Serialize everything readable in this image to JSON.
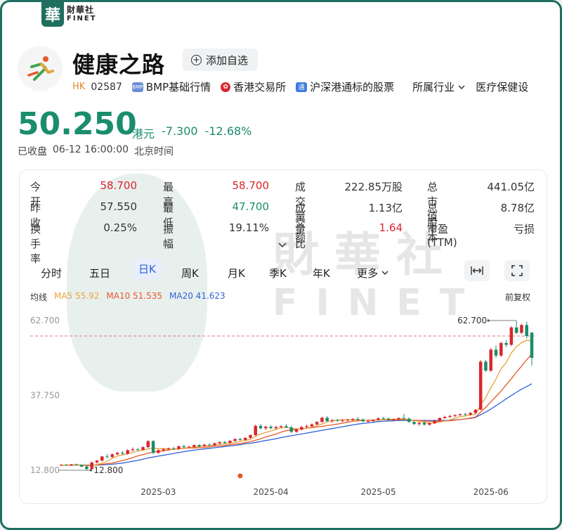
{
  "brand": {
    "seal_char": "華",
    "name_cn": "財華社",
    "name_en": "FINET"
  },
  "stock": {
    "name": "健康之路",
    "market": "HK",
    "code": "02587",
    "watch_label": "添加自选",
    "tags": [
      "BMP基础行情",
      "香港交易所",
      "沪深港通标的股票"
    ],
    "industry_label": "所属行业",
    "industry_value": "医疗保健设"
  },
  "price": {
    "last": "50.250",
    "currency": "港元",
    "change": "-7.300",
    "change_pct": "-12.68%"
  },
  "status": {
    "state": "已收盘",
    "time": "06-12 16:00:00",
    "tz": "北京时间"
  },
  "quote": [
    [
      {
        "label": "今开",
        "value": "58.700",
        "color": "red"
      },
      {
        "label": "最高",
        "value": "58.700",
        "color": "red"
      },
      {
        "label": "成交量",
        "value": "222.85万股",
        "color": "plain"
      },
      {
        "label": "总市值",
        "value": "441.05亿",
        "color": "plain",
        "caret": "▼"
      }
    ],
    [
      {
        "label": "昨收",
        "value": "57.550",
        "color": "plain"
      },
      {
        "label": "最低",
        "value": "47.700",
        "color": "green"
      },
      {
        "label": "成交额",
        "value": "1.13亿",
        "color": "plain"
      },
      {
        "label": "总股本",
        "value": "8.78亿",
        "color": "plain"
      }
    ],
    [
      {
        "label": "换手率",
        "value": "0.25%",
        "color": "plain"
      },
      {
        "label": "振幅",
        "value": "19.11%",
        "color": "plain"
      },
      {
        "label": "量比",
        "value": "1.64",
        "color": "red"
      },
      {
        "label": "市盈(TTM)",
        "value": "亏损",
        "color": "plain"
      }
    ]
  ],
  "expand_icon": "chevron-down-icon",
  "tabs": [
    "分时",
    "五日",
    "日K",
    "周K",
    "月K",
    "季K",
    "年K",
    "更多"
  ],
  "active_tab": "日K",
  "ma": {
    "label": "均线",
    "ma5": "MA5 55.92",
    "ma10": "MA10 51.535",
    "ma20": "MA20 41.623",
    "fuquan": "前复权"
  },
  "colors": {
    "up": "#d9262e",
    "down": "#1a8d6c",
    "ma5": "#e8a33a",
    "ma10": "#e8582a",
    "ma20": "#2f62d8",
    "accent": "#1f6e60"
  },
  "watermark": {
    "cn": "財華社",
    "en": "FINET"
  },
  "chart_data": {
    "type": "candlestick",
    "y_ticks": [
      "62.700",
      "37.750",
      "12.800"
    ],
    "ylim": [
      12.8,
      62.7
    ],
    "x_ticks": [
      "2025-03",
      "2025-04",
      "2025-05",
      "2025-06"
    ],
    "high_label": "62.700",
    "low_label": "12.800",
    "prev_close": 57.55,
    "ma5_last": 55.92,
    "ma10_last": 51.535,
    "ma20_last": 41.623,
    "candles": [
      [
        14.5,
        14.8,
        14.2,
        14.6
      ],
      [
        14.6,
        14.9,
        14.3,
        14.5
      ],
      [
        14.5,
        14.9,
        14.2,
        14.8
      ],
      [
        14.8,
        15.0,
        14.5,
        14.6
      ],
      [
        14.6,
        14.8,
        13.8,
        14.0
      ],
      [
        14.0,
        14.3,
        12.8,
        13.2
      ],
      [
        13.2,
        15.6,
        13.0,
        15.4
      ],
      [
        15.4,
        16.3,
        15.0,
        16.0
      ],
      [
        16.0,
        17.6,
        15.8,
        17.4
      ],
      [
        17.4,
        18.2,
        16.8,
        17.2
      ],
      [
        17.2,
        18.4,
        17.0,
        18.1
      ],
      [
        18.1,
        19.0,
        17.8,
        18.6
      ],
      [
        18.6,
        19.2,
        18.0,
        18.3
      ],
      [
        18.3,
        19.8,
        18.0,
        19.5
      ],
      [
        19.5,
        20.4,
        19.0,
        19.8
      ],
      [
        19.8,
        20.2,
        19.2,
        19.6
      ],
      [
        19.6,
        20.8,
        19.4,
        20.5
      ],
      [
        20.5,
        22.8,
        20.2,
        22.5
      ],
      [
        22.5,
        22.9,
        18.2,
        18.6
      ],
      [
        18.6,
        19.8,
        18.3,
        19.5
      ],
      [
        19.5,
        20.2,
        19.0,
        19.8
      ],
      [
        19.8,
        20.4,
        19.4,
        20.1
      ],
      [
        20.1,
        20.6,
        19.6,
        19.9
      ],
      [
        19.9,
        21.0,
        19.6,
        20.8
      ],
      [
        20.8,
        21.3,
        20.2,
        20.5
      ],
      [
        20.5,
        21.0,
        20.0,
        20.6
      ],
      [
        20.6,
        21.4,
        20.3,
        21.2
      ],
      [
        21.2,
        21.5,
        20.5,
        20.8
      ],
      [
        20.8,
        21.6,
        20.6,
        21.3
      ],
      [
        21.3,
        21.8,
        20.9,
        21.1
      ],
      [
        21.1,
        22.0,
        20.9,
        21.8
      ],
      [
        21.8,
        22.4,
        21.4,
        22.2
      ],
      [
        22.2,
        22.6,
        21.5,
        21.9
      ],
      [
        21.9,
        22.8,
        21.7,
        22.6
      ],
      [
        22.6,
        23.4,
        22.3,
        23.2
      ],
      [
        23.2,
        23.6,
        22.6,
        22.9
      ],
      [
        22.9,
        23.8,
        22.7,
        23.6
      ],
      [
        23.6,
        24.8,
        23.3,
        24.5
      ],
      [
        24.5,
        28.0,
        24.2,
        27.6
      ],
      [
        27.6,
        28.3,
        26.4,
        26.8
      ],
      [
        26.8,
        27.6,
        26.2,
        27.3
      ],
      [
        27.3,
        27.9,
        26.5,
        26.8
      ],
      [
        26.8,
        27.6,
        26.3,
        27.2
      ],
      [
        27.2,
        27.8,
        26.8,
        27.5
      ],
      [
        27.5,
        28.2,
        26.9,
        27.1
      ],
      [
        27.1,
        27.6,
        25.2,
        25.6
      ],
      [
        25.6,
        26.8,
        25.3,
        26.4
      ],
      [
        26.4,
        27.6,
        26.0,
        27.2
      ],
      [
        27.2,
        28.0,
        26.8,
        27.5
      ],
      [
        27.5,
        28.4,
        27.2,
        28.1
      ],
      [
        28.1,
        29.2,
        27.8,
        28.9
      ],
      [
        28.9,
        30.6,
        28.6,
        30.3
      ],
      [
        30.3,
        30.8,
        28.8,
        29.2
      ],
      [
        29.2,
        29.8,
        28.6,
        29.5
      ],
      [
        29.5,
        29.9,
        28.9,
        29.3
      ],
      [
        29.3,
        29.8,
        28.8,
        29.4
      ],
      [
        29.4,
        29.9,
        29.0,
        29.6
      ],
      [
        29.6,
        30.2,
        29.2,
        29.9
      ],
      [
        29.9,
        30.5,
        29.4,
        29.7
      ],
      [
        29.7,
        30.1,
        28.8,
        29.1
      ],
      [
        29.1,
        29.6,
        28.6,
        29.2
      ],
      [
        29.2,
        29.8,
        28.9,
        29.6
      ],
      [
        29.6,
        30.4,
        29.3,
        30.1
      ],
      [
        30.1,
        30.6,
        29.7,
        30.0
      ],
      [
        30.0,
        30.3,
        29.4,
        29.6
      ],
      [
        29.6,
        30.0,
        29.1,
        29.8
      ],
      [
        29.8,
        30.4,
        29.5,
        30.2
      ],
      [
        30.2,
        31.6,
        29.9,
        30.0
      ],
      [
        30.0,
        30.4,
        28.6,
        28.9
      ],
      [
        28.9,
        29.3,
        27.9,
        28.2
      ],
      [
        28.2,
        28.9,
        27.6,
        28.6
      ],
      [
        28.6,
        29.1,
        27.7,
        28.0
      ],
      [
        28.0,
        28.8,
        27.6,
        28.5
      ],
      [
        28.5,
        29.6,
        28.2,
        29.3
      ],
      [
        29.3,
        30.4,
        29.0,
        30.2
      ],
      [
        30.2,
        31.0,
        29.9,
        30.6
      ],
      [
        30.6,
        31.2,
        30.2,
        30.9
      ],
      [
        30.9,
        31.4,
        30.5,
        31.2
      ],
      [
        31.2,
        31.7,
        30.8,
        31.5
      ],
      [
        31.5,
        32.0,
        31.0,
        31.3
      ],
      [
        31.3,
        32.2,
        31.1,
        31.9
      ],
      [
        31.9,
        33.2,
        31.6,
        33.0
      ],
      [
        33.0,
        49.5,
        32.8,
        49.0
      ],
      [
        49.0,
        49.6,
        45.6,
        46.0
      ],
      [
        46.0,
        53.5,
        45.6,
        53.0
      ],
      [
        53.0,
        54.4,
        50.2,
        51.0
      ],
      [
        51.0,
        55.6,
        50.6,
        55.2
      ],
      [
        55.2,
        56.2,
        53.8,
        54.6
      ],
      [
        54.6,
        60.8,
        54.2,
        60.4
      ],
      [
        60.4,
        62.7,
        58.2,
        58.6
      ],
      [
        58.6,
        61.6,
        58.2,
        61.2
      ],
      [
        61.2,
        62.3,
        56.8,
        57.55
      ],
      [
        58.7,
        58.7,
        47.7,
        50.25
      ]
    ],
    "ma5": [
      14.5,
      14.5,
      14.6,
      14.6,
      14.5,
      14.2,
      14.4,
      14.7,
      15.2,
      15.8,
      16.8,
      17.5,
      17.9,
      18.3,
      18.7,
      19.2,
      19.5,
      19.9,
      20.2,
      20.0,
      20.0,
      19.9,
      19.7,
      19.9,
      20.2,
      20.3,
      20.5,
      20.7,
      20.9,
      21.0,
      21.2,
      21.4,
      21.6,
      21.8,
      22.1,
      22.4,
      22.7,
      23.1,
      24.0,
      24.9,
      25.4,
      25.9,
      26.4,
      26.9,
      27.1,
      26.8,
      26.6,
      26.5,
      26.8,
      27.2,
      27.7,
      28.2,
      28.9,
      29.3,
      29.5,
      29.6,
      29.7,
      29.6,
      29.6,
      29.5,
      29.4,
      29.4,
      29.5,
      29.7,
      29.8,
      29.8,
      29.9,
      29.9,
      29.7,
      29.4,
      29.1,
      28.8,
      28.5,
      28.5,
      28.9,
      29.2,
      29.6,
      30.2,
      30.6,
      30.9,
      31.2,
      31.5,
      34.5,
      37.1,
      40.3,
      43.2,
      46.6,
      48.7,
      51.9,
      54.0,
      55.3,
      56.1,
      55.92
    ],
    "ma10": [
      14.5,
      14.5,
      14.5,
      14.6,
      14.5,
      14.4,
      14.5,
      14.6,
      14.8,
      15.0,
      15.2,
      15.6,
      16.0,
      16.5,
      17.0,
      17.6,
      18.0,
      18.5,
      18.8,
      19.1,
      19.3,
      19.6,
      19.8,
      20.0,
      20.1,
      20.2,
      20.2,
      20.3,
      20.4,
      20.6,
      20.8,
      20.9,
      21.1,
      21.3,
      21.5,
      21.7,
      22.0,
      22.3,
      22.8,
      23.3,
      23.9,
      24.4,
      24.9,
      25.5,
      26.0,
      26.2,
      26.4,
      26.6,
      26.8,
      27.0,
      27.2,
      27.4,
      27.7,
      27.9,
      28.2,
      28.5,
      28.8,
      29.1,
      29.3,
      29.4,
      29.5,
      29.5,
      29.5,
      29.6,
      29.6,
      29.6,
      29.7,
      29.7,
      29.6,
      29.5,
      29.4,
      29.2,
      29.1,
      29.0,
      29.1,
      29.2,
      29.3,
      29.5,
      29.7,
      29.9,
      30.2,
      30.5,
      32.2,
      33.8,
      35.6,
      37.4,
      39.2,
      41.3,
      43.3,
      45.5,
      47.5,
      49.6,
      51.535
    ],
    "ma20": [
      14.5,
      14.5,
      14.5,
      14.5,
      14.5,
      14.5,
      14.5,
      14.5,
      14.6,
      14.7,
      14.8,
      15.0,
      15.2,
      15.5,
      15.8,
      16.1,
      16.5,
      16.9,
      17.2,
      17.5,
      17.8,
      18.1,
      18.4,
      18.7,
      19.0,
      19.3,
      19.5,
      19.7,
      19.9,
      20.1,
      20.3,
      20.5,
      20.7,
      20.9,
      21.1,
      21.3,
      21.6,
      21.8,
      22.1,
      22.4,
      22.7,
      23.0,
      23.3,
      23.7,
      24.0,
      24.3,
      24.6,
      24.9,
      25.2,
      25.5,
      25.8,
      26.1,
      26.4,
      26.7,
      27.0,
      27.3,
      27.6,
      27.9,
      28.2,
      28.4,
      28.6,
      28.8,
      29.0,
      29.1,
      29.2,
      29.3,
      29.4,
      29.4,
      29.4,
      29.4,
      29.4,
      29.4,
      29.4,
      29.4,
      29.4,
      29.4,
      29.5,
      29.6,
      29.7,
      29.9,
      30.1,
      30.4,
      31.3,
      32.2,
      33.2,
      34.3,
      35.4,
      36.6,
      37.7,
      38.8,
      39.8,
      40.7,
      41.623
    ],
    "marker_index": 35
  }
}
